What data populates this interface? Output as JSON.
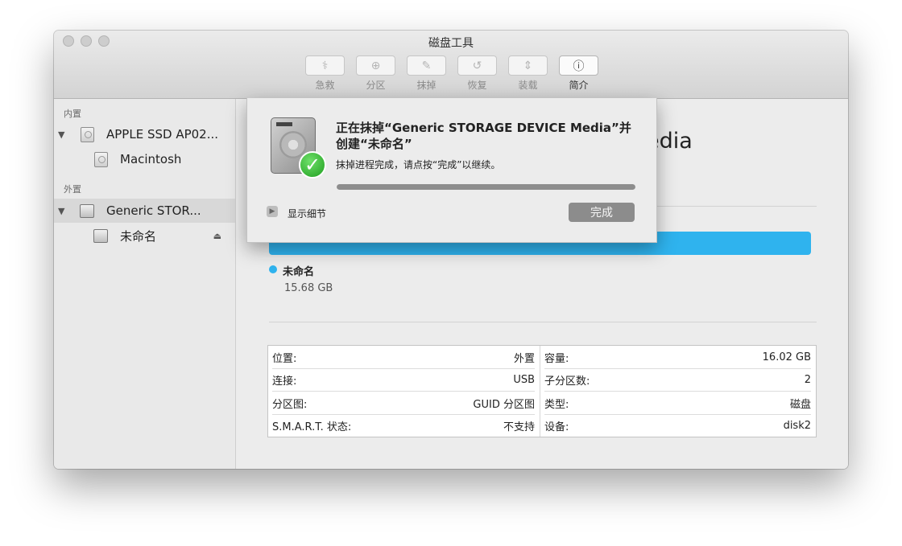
{
  "window": {
    "title": "磁盘工具"
  },
  "toolbar": {
    "items": [
      {
        "label": "急救",
        "icon": "stethoscope-icon",
        "glyph": "⚕",
        "active": false
      },
      {
        "label": "分区",
        "icon": "partition-icon",
        "glyph": "⊕",
        "active": false
      },
      {
        "label": "抹掉",
        "icon": "erase-icon",
        "glyph": "✎",
        "active": false
      },
      {
        "label": "恢复",
        "icon": "restore-icon",
        "glyph": "↺",
        "active": false
      },
      {
        "label": "装载",
        "icon": "mount-icon",
        "glyph": "⇕",
        "active": false
      },
      {
        "label": "简介",
        "icon": "info-icon",
        "glyph": "ⓘ",
        "active": true
      }
    ]
  },
  "sidebar": {
    "internal_header": "内置",
    "external_header": "外置",
    "internal_disk": "APPLE SSD AP02...",
    "internal_volume": "Macintosh",
    "external_disk": "Generic STOR...",
    "external_volume": "未命名",
    "eject_glyph": "⏏",
    "triangle_glyph": "▼"
  },
  "main": {
    "title_fragment": "edia",
    "volume_name": "未命名",
    "volume_size": "15.68 GB",
    "volume_color": "#2fb3ee",
    "info_left": [
      {
        "label": "位置:",
        "value": "外置"
      },
      {
        "label": "连接:",
        "value": "USB"
      },
      {
        "label": "分区图:",
        "value": "GUID 分区图"
      },
      {
        "label": "S.M.A.R.T. 状态:",
        "value": "不支持"
      }
    ],
    "info_right": [
      {
        "label": "容量:",
        "value": "16.02 GB"
      },
      {
        "label": "子分区数:",
        "value": "2"
      },
      {
        "label": "类型:",
        "value": "磁盘"
      },
      {
        "label": "设备:",
        "value": "disk2"
      }
    ]
  },
  "sheet": {
    "title": "正在抹掉“Generic STORAGE DEVICE Media”并创建“未命名”",
    "message": "抹掉进程完成，请点按“完成”以继续。",
    "progress": 1.0,
    "show_details": "显示细节",
    "done": "完成",
    "check_glyph": "✓",
    "disclosure_glyph": "▶"
  }
}
